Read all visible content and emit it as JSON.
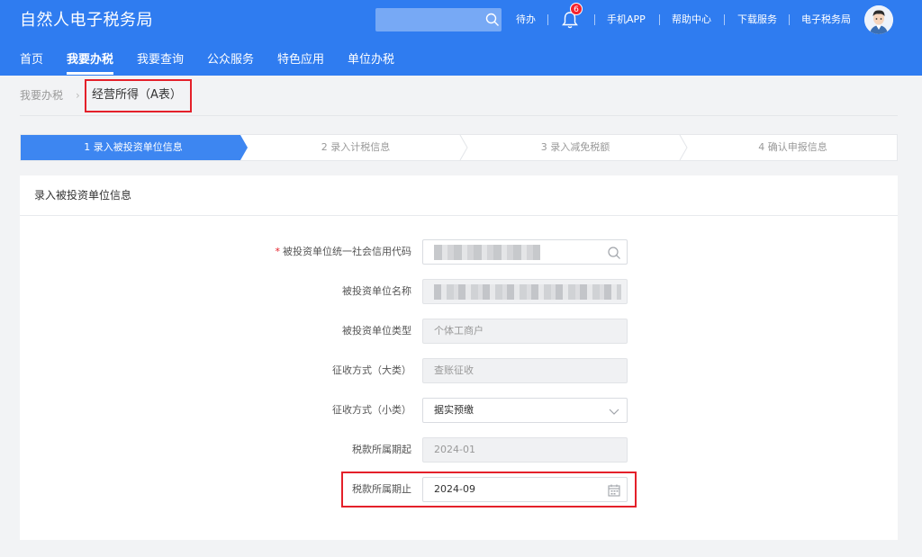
{
  "header": {
    "brand": "自然人电子税务局",
    "todo": "待办",
    "notification_count": "6",
    "links": [
      "手机APP",
      "帮助中心",
      "下载服务",
      "电子税务局"
    ],
    "colors": {
      "primary": "#2f7cf0",
      "badge": "#f5222d",
      "highlight": "#e4202a"
    }
  },
  "nav": {
    "items": [
      "首页",
      "我要办税",
      "我要查询",
      "公众服务",
      "特色应用",
      "单位办税"
    ],
    "active": "我要办税"
  },
  "breadcrumb": {
    "root": "我要办税",
    "separator": "›",
    "current": "经营所得（A表）"
  },
  "steps": [
    {
      "label": "1  录入被投资单位信息",
      "active": true
    },
    {
      "label": "2  录入计税信息",
      "active": false
    },
    {
      "label": "3  录入减免税额",
      "active": false
    },
    {
      "label": "4  确认申报信息",
      "active": false
    }
  ],
  "panel": {
    "title": "录入被投资单位信息"
  },
  "form": {
    "credit_code": {
      "required_mark": "*",
      "label": "被投资单位统一社会信用代码",
      "value": ""
    },
    "unit_name": {
      "label": "被投资单位名称",
      "value": ""
    },
    "unit_type": {
      "label": "被投资单位类型",
      "value": "个体工商户"
    },
    "levy_major": {
      "label": "征收方式（大类）",
      "value": "查账征收"
    },
    "levy_minor": {
      "label": "征收方式（小类）",
      "value": "据实预缴"
    },
    "period_start": {
      "label": "税款所属期起",
      "value": "2024-01"
    },
    "period_end": {
      "label": "税款所属期止",
      "value": "2024-09"
    }
  }
}
